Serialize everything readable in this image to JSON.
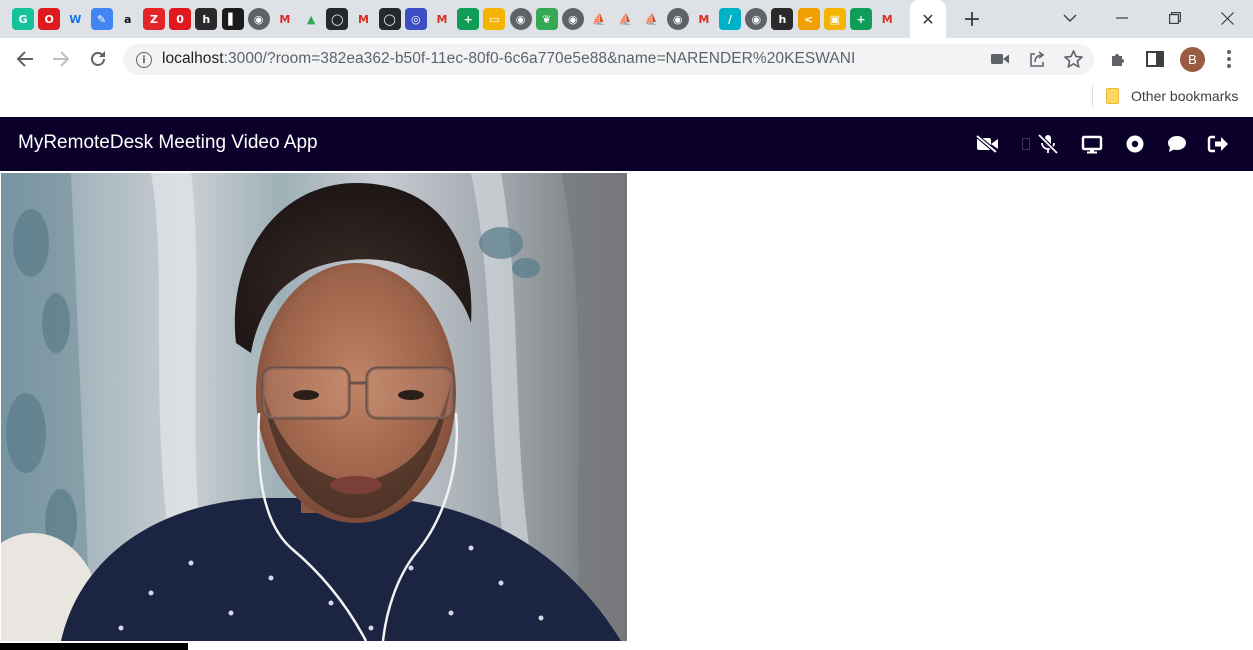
{
  "browser": {
    "tabs": [
      {
        "icon": "grammarly-icon",
        "color": "#15c39a",
        "glyph": "G"
      },
      {
        "icon": "opera-icon",
        "color": "#e0191f",
        "glyph": "O"
      },
      {
        "icon": "wifi-w-icon",
        "color": "#ffffff",
        "glyph": "W"
      },
      {
        "icon": "edit-icon",
        "color": "#4285f4",
        "glyph": "✎"
      },
      {
        "icon": "amazon-icon",
        "color": "#ffffff",
        "glyph": "a"
      },
      {
        "icon": "zoho-icon",
        "color": "#e42527",
        "glyph": "Z"
      },
      {
        "icon": "opera-red-icon",
        "color": "#e0191f",
        "glyph": "0"
      },
      {
        "icon": "hashnode-icon",
        "color": "#2a2a2a",
        "glyph": "h"
      },
      {
        "icon": "book-icon",
        "color": "#1b1b1b",
        "glyph": "▌"
      },
      {
        "icon": "globe-icon",
        "color": "#5f6368",
        "glyph": "◉"
      },
      {
        "icon": "gmail-icon",
        "color": "#ffffff",
        "glyph": "M"
      },
      {
        "icon": "drive-icon",
        "color": "#ffffff",
        "glyph": "▲"
      },
      {
        "icon": "github-icon",
        "color": "#24292e",
        "glyph": "◯"
      },
      {
        "icon": "gmail-icon",
        "color": "#ffffff",
        "glyph": "M"
      },
      {
        "icon": "github-icon",
        "color": "#24292e",
        "glyph": "◯"
      },
      {
        "icon": "app-icon",
        "color": "#3c4ec2",
        "glyph": "◎"
      },
      {
        "icon": "gmail-icon",
        "color": "#ffffff",
        "glyph": "M"
      },
      {
        "icon": "sheets-plus-icon",
        "color": "#0f9d58",
        "glyph": "+"
      },
      {
        "icon": "slides-icon",
        "color": "#f4b400",
        "glyph": "▭"
      },
      {
        "icon": "globe-icon",
        "color": "#5f6368",
        "glyph": "◉"
      },
      {
        "icon": "chrome-ext-icon",
        "color": "#34a853",
        "glyph": "❦"
      },
      {
        "icon": "globe-icon",
        "color": "#5f6368",
        "glyph": "◉"
      },
      {
        "icon": "phpmyadmin-icon",
        "color": "#f89c0e",
        "glyph": "⛵"
      },
      {
        "icon": "phpmyadmin-icon",
        "color": "#f89c0e",
        "glyph": "⛵"
      },
      {
        "icon": "phpmyadmin-icon",
        "color": "#f89c0e",
        "glyph": "⛵"
      },
      {
        "icon": "globe-icon",
        "color": "#5f6368",
        "glyph": "◉"
      },
      {
        "icon": "gmail-icon",
        "color": "#ffffff",
        "glyph": "M"
      },
      {
        "icon": "pen-icon",
        "color": "#00b2c8",
        "glyph": "/"
      },
      {
        "icon": "globe-icon",
        "color": "#5f6368",
        "glyph": "◉"
      },
      {
        "icon": "hashnode-icon",
        "color": "#2a2a2a",
        "glyph": "h"
      },
      {
        "icon": "code-icon",
        "color": "#f0a000",
        "glyph": "<"
      },
      {
        "icon": "classroom-icon",
        "color": "#f4b400",
        "glyph": "▣"
      },
      {
        "icon": "sheets-plus-icon",
        "color": "#0f9d58",
        "glyph": "+"
      },
      {
        "icon": "gmail-icon",
        "color": "#ffffff",
        "glyph": "M"
      }
    ],
    "active_tab_close": "✕",
    "new_tab": "+",
    "url_host": "localhost",
    "url_rest": ":3000/?room=382ea362-b50f-11ec-80f0-6c6a770e5e88&name=NARENDER%20KESWANI",
    "profile_initial": "B",
    "other_bookmarks": "Other bookmarks"
  },
  "app": {
    "title": "MyRemoteDesk Meeting Video App",
    "header_color": "#0a0029",
    "controls": [
      {
        "name": "video-off-icon"
      },
      {
        "name": "mic-off-icon"
      },
      {
        "name": "screen-share-icon"
      },
      {
        "name": "record-icon"
      },
      {
        "name": "chat-icon"
      },
      {
        "name": "leave-icon"
      }
    ]
  }
}
